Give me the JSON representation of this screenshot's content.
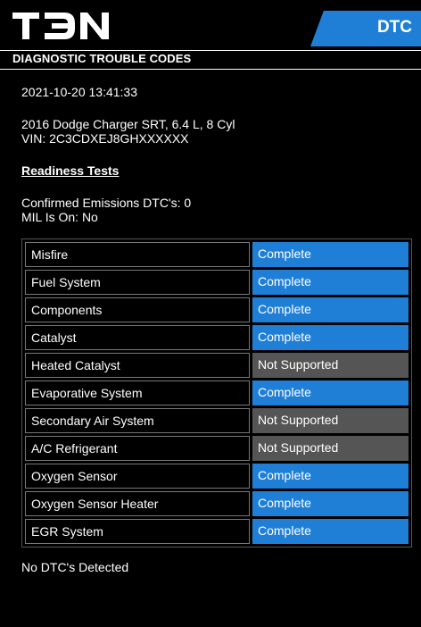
{
  "header": {
    "logo_alt": "TDN",
    "tab_label": "DTC"
  },
  "title": "DIAGNOSTIC TROUBLE CODES",
  "report": {
    "timestamp": "2021-10-20 13:41:33",
    "vehicle": "2016 Dodge Charger SRT, 6.4 L, 8 Cyl",
    "vin": "VIN: 2C3CDXEJ8GHXXXXXX",
    "readiness_heading": "Readiness Tests",
    "confirmed": "Confirmed Emissions DTC's: 0",
    "mil": "MIL Is On: No",
    "footer": "No DTC's Detected"
  },
  "readiness": [
    {
      "name": "Misfire",
      "status": "Complete"
    },
    {
      "name": "Fuel System",
      "status": "Complete"
    },
    {
      "name": "Components",
      "status": "Complete"
    },
    {
      "name": "Catalyst",
      "status": "Complete"
    },
    {
      "name": "Heated Catalyst",
      "status": "Not Supported"
    },
    {
      "name": "Evaporative System",
      "status": "Complete"
    },
    {
      "name": "Secondary Air System",
      "status": "Not Supported"
    },
    {
      "name": "A/C Refrigerant",
      "status": "Not Supported"
    },
    {
      "name": "Oxygen Sensor",
      "status": "Complete"
    },
    {
      "name": "Oxygen Sensor Heater",
      "status": "Complete"
    },
    {
      "name": "EGR System",
      "status": "Complete"
    }
  ],
  "colors": {
    "complete": "#1f7fd6",
    "not_supported": "#555555"
  }
}
